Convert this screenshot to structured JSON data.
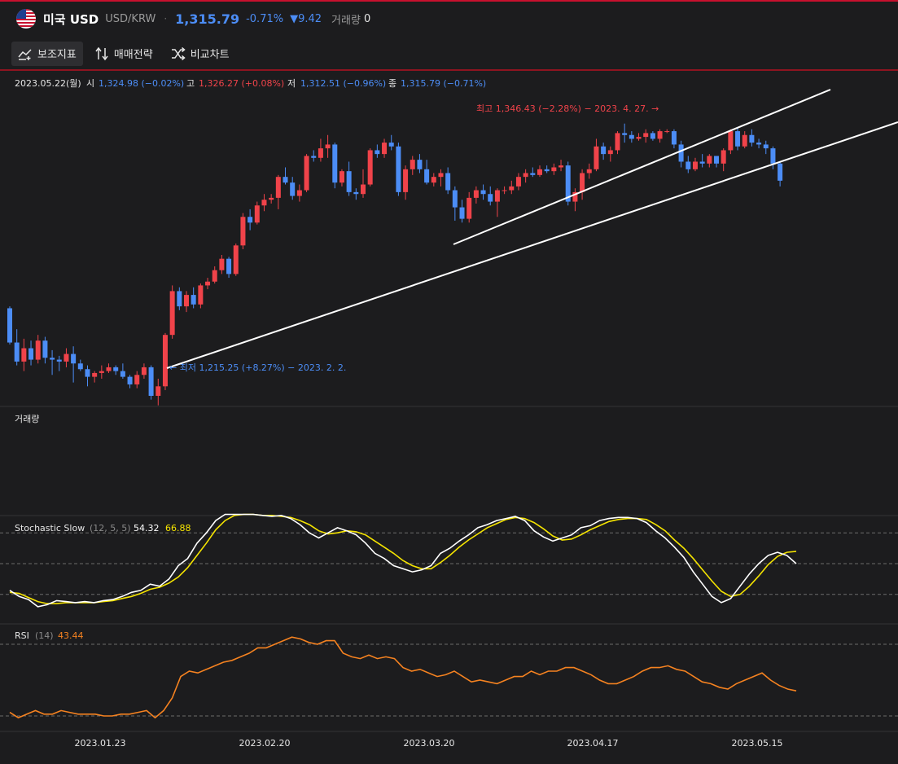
{
  "header": {
    "title": "미국 USD",
    "pair": "USD/KRW",
    "separator": "·",
    "price": "1,315.79",
    "change_pct": "-0.71%",
    "change_abs": "▼9.42",
    "volume_label": "거래량",
    "volume_value": "0"
  },
  "toolbar": {
    "indicators": "보조지표",
    "strategy": "매매전략",
    "compare": "비교차트"
  },
  "ohlc_row": {
    "date": "2023.05.22(월)",
    "open_label": "시",
    "open": "1,324.98 (−0.02%)",
    "high_label": "고",
    "high": "1,326.27 (+0.08%)",
    "low_label": "저",
    "low": "1,312.51 (−0.96%)",
    "close_label": "종",
    "close": "1,315.79 (−0.71%)"
  },
  "annotations": {
    "max_label": "최고 1,346.43 (−2.28%) − 2023. 4. 27. →",
    "min_label": "← 최저 1,215.25 (+8.27%) − 2023. 2. 2."
  },
  "panels": {
    "volume_label": "거래량",
    "stoch_label": "Stochastic Slow",
    "stoch_params": "(12, 5, 5)",
    "stoch_k": "54.32",
    "stoch_d": "66.88",
    "rsi_label": "RSI",
    "rsi_params": "(14)",
    "rsi_value": "43.44"
  },
  "colors": {
    "up": "#f0434a",
    "down": "#4c8df6",
    "stoch_k": "#ffffff",
    "stoch_d": "#f5e400",
    "rsi": "#f58220",
    "accent": "#c8102e"
  },
  "chart_data": [
    {
      "type": "candlestick",
      "title": "미국 USD",
      "x_tick_labels": [
        "2023.01.23",
        "2023.02.20",
        "2023.03.20",
        "2023.04.17",
        "2023.05.15"
      ],
      "ylim": [
        1200,
        1360
      ],
      "candles": [
        {
          "o": 1249,
          "h": 1250,
          "l": 1230,
          "c": 1231
        },
        {
          "o": 1231,
          "h": 1238,
          "l": 1219,
          "c": 1221
        },
        {
          "o": 1221,
          "h": 1233,
          "l": 1216,
          "c": 1228
        },
        {
          "o": 1228,
          "h": 1232,
          "l": 1219,
          "c": 1222
        },
        {
          "o": 1222,
          "h": 1235,
          "l": 1220,
          "c": 1232
        },
        {
          "o": 1232,
          "h": 1234,
          "l": 1220,
          "c": 1223
        },
        {
          "o": 1223,
          "h": 1227,
          "l": 1214,
          "c": 1222
        },
        {
          "o": 1222,
          "h": 1224,
          "l": 1216,
          "c": 1221
        },
        {
          "o": 1221,
          "h": 1228,
          "l": 1218,
          "c": 1225
        },
        {
          "o": 1225,
          "h": 1229,
          "l": 1210,
          "c": 1220
        },
        {
          "o": 1220,
          "h": 1222,
          "l": 1216,
          "c": 1217
        },
        {
          "o": 1217,
          "h": 1219,
          "l": 1208,
          "c": 1213
        },
        {
          "o": 1213,
          "h": 1216,
          "l": 1210,
          "c": 1215
        },
        {
          "o": 1215,
          "h": 1219,
          "l": 1212,
          "c": 1216
        },
        {
          "o": 1216,
          "h": 1220,
          "l": 1215,
          "c": 1218
        },
        {
          "o": 1218,
          "h": 1219,
          "l": 1214,
          "c": 1216
        },
        {
          "o": 1216,
          "h": 1220,
          "l": 1212,
          "c": 1213
        },
        {
          "o": 1213,
          "h": 1214,
          "l": 1207,
          "c": 1209
        },
        {
          "o": 1209,
          "h": 1216,
          "l": 1207,
          "c": 1214
        },
        {
          "o": 1214,
          "h": 1220,
          "l": 1212,
          "c": 1218
        },
        {
          "o": 1218,
          "h": 1219,
          "l": 1201,
          "c": 1203
        },
        {
          "o": 1203,
          "h": 1212,
          "l": 1198,
          "c": 1208
        },
        {
          "o": 1208,
          "h": 1236,
          "l": 1206,
          "c": 1235
        },
        {
          "o": 1235,
          "h": 1261,
          "l": 1233,
          "c": 1258
        },
        {
          "o": 1258,
          "h": 1260,
          "l": 1248,
          "c": 1250
        },
        {
          "o": 1250,
          "h": 1258,
          "l": 1247,
          "c": 1256
        },
        {
          "o": 1256,
          "h": 1260,
          "l": 1249,
          "c": 1251
        },
        {
          "o": 1251,
          "h": 1262,
          "l": 1249,
          "c": 1261
        },
        {
          "o": 1261,
          "h": 1265,
          "l": 1259,
          "c": 1263
        },
        {
          "o": 1263,
          "h": 1271,
          "l": 1262,
          "c": 1269
        },
        {
          "o": 1269,
          "h": 1277,
          "l": 1267,
          "c": 1275
        },
        {
          "o": 1275,
          "h": 1276,
          "l": 1265,
          "c": 1267
        },
        {
          "o": 1267,
          "h": 1283,
          "l": 1266,
          "c": 1282
        },
        {
          "o": 1282,
          "h": 1299,
          "l": 1280,
          "c": 1297
        },
        {
          "o": 1297,
          "h": 1301,
          "l": 1290,
          "c": 1294
        },
        {
          "o": 1294,
          "h": 1305,
          "l": 1293,
          "c": 1303
        },
        {
          "o": 1303,
          "h": 1309,
          "l": 1300,
          "c": 1306
        },
        {
          "o": 1306,
          "h": 1309,
          "l": 1304,
          "c": 1307
        },
        {
          "o": 1307,
          "h": 1319,
          "l": 1301,
          "c": 1318
        },
        {
          "o": 1318,
          "h": 1323,
          "l": 1314,
          "c": 1315
        },
        {
          "o": 1315,
          "h": 1318,
          "l": 1306,
          "c": 1308
        },
        {
          "o": 1308,
          "h": 1314,
          "l": 1305,
          "c": 1311
        },
        {
          "o": 1311,
          "h": 1330,
          "l": 1310,
          "c": 1329
        },
        {
          "o": 1329,
          "h": 1332,
          "l": 1326,
          "c": 1328
        },
        {
          "o": 1328,
          "h": 1338,
          "l": 1326,
          "c": 1333
        },
        {
          "o": 1333,
          "h": 1340,
          "l": 1328,
          "c": 1335
        },
        {
          "o": 1335,
          "h": 1336,
          "l": 1312,
          "c": 1315
        },
        {
          "o": 1315,
          "h": 1322,
          "l": 1313,
          "c": 1321
        },
        {
          "o": 1321,
          "h": 1326,
          "l": 1308,
          "c": 1310
        },
        {
          "o": 1310,
          "h": 1312,
          "l": 1306,
          "c": 1309
        },
        {
          "o": 1309,
          "h": 1322,
          "l": 1307,
          "c": 1314
        },
        {
          "o": 1314,
          "h": 1333,
          "l": 1313,
          "c": 1332
        },
        {
          "o": 1332,
          "h": 1335,
          "l": 1328,
          "c": 1330
        },
        {
          "o": 1330,
          "h": 1338,
          "l": 1328,
          "c": 1336
        },
        {
          "o": 1336,
          "h": 1340,
          "l": 1332,
          "c": 1334
        },
        {
          "o": 1334,
          "h": 1336,
          "l": 1308,
          "c": 1310
        },
        {
          "o": 1310,
          "h": 1324,
          "l": 1306,
          "c": 1322
        },
        {
          "o": 1322,
          "h": 1329,
          "l": 1319,
          "c": 1327
        },
        {
          "o": 1327,
          "h": 1330,
          "l": 1320,
          "c": 1322
        },
        {
          "o": 1322,
          "h": 1327,
          "l": 1314,
          "c": 1315
        },
        {
          "o": 1315,
          "h": 1320,
          "l": 1313,
          "c": 1318
        },
        {
          "o": 1318,
          "h": 1322,
          "l": 1313,
          "c": 1320
        },
        {
          "o": 1320,
          "h": 1323,
          "l": 1309,
          "c": 1311
        },
        {
          "o": 1311,
          "h": 1313,
          "l": 1295,
          "c": 1302
        },
        {
          "o": 1302,
          "h": 1306,
          "l": 1294,
          "c": 1296
        },
        {
          "o": 1296,
          "h": 1310,
          "l": 1294,
          "c": 1307
        },
        {
          "o": 1307,
          "h": 1313,
          "l": 1304,
          "c": 1311
        },
        {
          "o": 1311,
          "h": 1314,
          "l": 1306,
          "c": 1309
        },
        {
          "o": 1309,
          "h": 1313,
          "l": 1303,
          "c": 1305
        },
        {
          "o": 1305,
          "h": 1312,
          "l": 1297,
          "c": 1311
        },
        {
          "o": 1311,
          "h": 1313,
          "l": 1309,
          "c": 1311
        },
        {
          "o": 1311,
          "h": 1316,
          "l": 1309,
          "c": 1313
        },
        {
          "o": 1313,
          "h": 1320,
          "l": 1311,
          "c": 1318
        },
        {
          "o": 1318,
          "h": 1322,
          "l": 1315,
          "c": 1320
        },
        {
          "o": 1320,
          "h": 1323,
          "l": 1318,
          "c": 1319
        },
        {
          "o": 1319,
          "h": 1324,
          "l": 1318,
          "c": 1322
        },
        {
          "o": 1322,
          "h": 1324,
          "l": 1320,
          "c": 1321
        },
        {
          "o": 1321,
          "h": 1325,
          "l": 1319,
          "c": 1323
        },
        {
          "o": 1323,
          "h": 1327,
          "l": 1321,
          "c": 1324
        },
        {
          "o": 1324,
          "h": 1326,
          "l": 1303,
          "c": 1305
        },
        {
          "o": 1305,
          "h": 1312,
          "l": 1300,
          "c": 1310
        },
        {
          "o": 1310,
          "h": 1322,
          "l": 1306,
          "c": 1320
        },
        {
          "o": 1320,
          "h": 1325,
          "l": 1317,
          "c": 1322
        },
        {
          "o": 1322,
          "h": 1338,
          "l": 1321,
          "c": 1334
        },
        {
          "o": 1334,
          "h": 1336,
          "l": 1327,
          "c": 1330
        },
        {
          "o": 1330,
          "h": 1334,
          "l": 1326,
          "c": 1332
        },
        {
          "o": 1332,
          "h": 1342,
          "l": 1330,
          "c": 1341
        },
        {
          "o": 1341,
          "h": 1346,
          "l": 1336,
          "c": 1340
        },
        {
          "o": 1340,
          "h": 1342,
          "l": 1336,
          "c": 1338
        },
        {
          "o": 1338,
          "h": 1341,
          "l": 1337,
          "c": 1339
        },
        {
          "o": 1339,
          "h": 1343,
          "l": 1336,
          "c": 1341
        },
        {
          "o": 1341,
          "h": 1342,
          "l": 1337,
          "c": 1338
        },
        {
          "o": 1338,
          "h": 1343,
          "l": 1336,
          "c": 1342
        },
        {
          "o": 1342,
          "h": 1343,
          "l": 1341,
          "c": 1342
        },
        {
          "o": 1342,
          "h": 1343,
          "l": 1333,
          "c": 1335
        },
        {
          "o": 1335,
          "h": 1337,
          "l": 1323,
          "c": 1326
        },
        {
          "o": 1326,
          "h": 1329,
          "l": 1320,
          "c": 1322
        },
        {
          "o": 1322,
          "h": 1328,
          "l": 1321,
          "c": 1326
        },
        {
          "o": 1326,
          "h": 1330,
          "l": 1323,
          "c": 1325
        },
        {
          "o": 1325,
          "h": 1330,
          "l": 1323,
          "c": 1329
        },
        {
          "o": 1329,
          "h": 1329,
          "l": 1323,
          "c": 1325
        },
        {
          "o": 1325,
          "h": 1333,
          "l": 1321,
          "c": 1332
        },
        {
          "o": 1332,
          "h": 1343,
          "l": 1330,
          "c": 1342
        },
        {
          "o": 1342,
          "h": 1344,
          "l": 1332,
          "c": 1334
        },
        {
          "o": 1334,
          "h": 1342,
          "l": 1333,
          "c": 1340
        },
        {
          "o": 1340,
          "h": 1343,
          "l": 1334,
          "c": 1336
        },
        {
          "o": 1336,
          "h": 1338,
          "l": 1333,
          "c": 1335
        },
        {
          "o": 1335,
          "h": 1337,
          "l": 1330,
          "c": 1333
        },
        {
          "o": 1333,
          "h": 1334,
          "l": 1322,
          "c": 1325
        },
        {
          "o": 1325,
          "h": 1326,
          "l": 1313,
          "c": 1316
        }
      ]
    },
    {
      "type": "line",
      "title": "Stochastic Slow",
      "ylim": [
        0,
        100
      ],
      "reference_lines": [
        20,
        50,
        80
      ],
      "series": [
        {
          "name": "54.32",
          "values": [
            24,
            18,
            15,
            8,
            10,
            14,
            13,
            12,
            13,
            12,
            14,
            15,
            18,
            22,
            24,
            30,
            28,
            35,
            48,
            55,
            70,
            80,
            92,
            98,
            98,
            98,
            98,
            97,
            96,
            97,
            94,
            88,
            80,
            75,
            80,
            85,
            82,
            78,
            70,
            60,
            55,
            48,
            45,
            42,
            44,
            48,
            60,
            65,
            72,
            78,
            85,
            88,
            92,
            94,
            96,
            92,
            82,
            76,
            72,
            75,
            78,
            85,
            87,
            92,
            94,
            95,
            95,
            94,
            90,
            82,
            75,
            66,
            56,
            42,
            30,
            18,
            12,
            16,
            28,
            40,
            50,
            58,
            61,
            58,
            50
          ]
        },
        {
          "name": "66.88",
          "values": [
            22,
            21,
            17,
            13,
            11,
            11,
            12,
            12,
            12,
            12,
            13,
            14,
            16,
            18,
            21,
            25,
            27,
            31,
            37,
            46,
            58,
            70,
            83,
            92,
            97,
            98,
            98,
            97,
            97,
            96,
            95,
            92,
            88,
            82,
            79,
            80,
            82,
            81,
            78,
            72,
            66,
            60,
            53,
            48,
            45,
            45,
            51,
            58,
            66,
            73,
            79,
            85,
            89,
            93,
            95,
            94,
            90,
            84,
            77,
            73,
            74,
            78,
            83,
            87,
            91,
            93,
            94,
            94,
            93,
            88,
            82,
            73,
            65,
            55,
            44,
            33,
            23,
            18,
            20,
            28,
            38,
            49,
            57,
            61,
            62
          ]
        }
      ]
    },
    {
      "type": "line",
      "title": "RSI",
      "ylim": [
        0,
        100
      ],
      "reference_lines": [
        30,
        70
      ],
      "series": [
        {
          "name": "43.44",
          "values": [
            32,
            29,
            31,
            33,
            31,
            31,
            33,
            32,
            31,
            31,
            31,
            30,
            30,
            31,
            31,
            32,
            33,
            29,
            33,
            40,
            52,
            55,
            54,
            56,
            58,
            60,
            61,
            63,
            65,
            68,
            68,
            70,
            72,
            74,
            73,
            71,
            70,
            72,
            72,
            65,
            63,
            62,
            64,
            62,
            63,
            62,
            57,
            55,
            56,
            54,
            52,
            53,
            55,
            52,
            49,
            50,
            49,
            48,
            50,
            52,
            52,
            55,
            53,
            55,
            55,
            57,
            57,
            55,
            53,
            50,
            48,
            48,
            50,
            52,
            55,
            57,
            57,
            58,
            56,
            55,
            52,
            49,
            48,
            46,
            45,
            48,
            50,
            52,
            54,
            50,
            47,
            45,
            44
          ]
        }
      ]
    }
  ]
}
